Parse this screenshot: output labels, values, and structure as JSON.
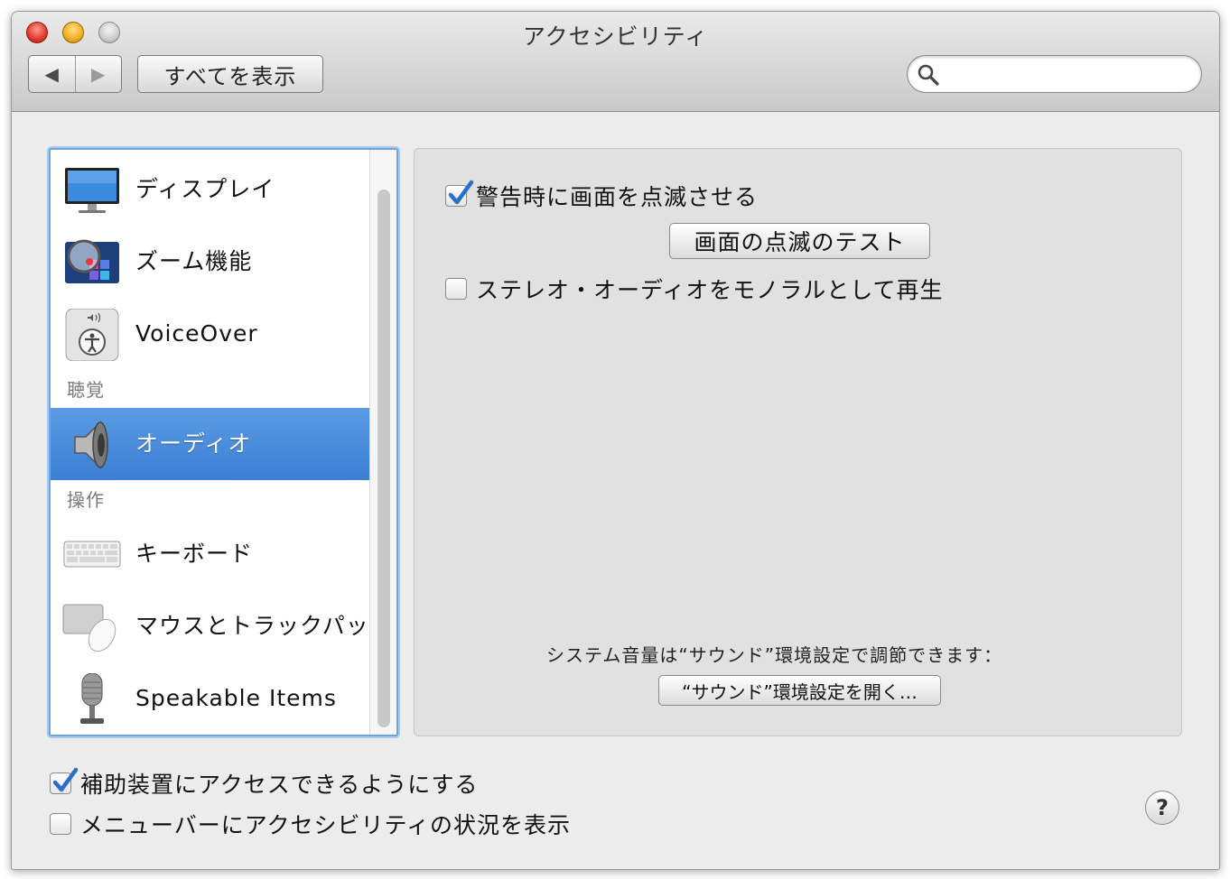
{
  "window": {
    "title": "アクセシビリティ"
  },
  "toolbar": {
    "back_glyph": "◀",
    "forward_glyph": "▶",
    "show_all_label": "すべてを表示",
    "search": {
      "value": "",
      "placeholder": "",
      "icon": "search-icon"
    }
  },
  "sidebar": {
    "items": [
      {
        "label": "ディスプレイ",
        "icon": "display-icon",
        "selected": false
      },
      {
        "label": "ズーム機能",
        "icon": "zoom-icon",
        "selected": false
      },
      {
        "label": "VoiceOver",
        "icon": "voiceover-icon",
        "selected": false
      },
      {
        "label": "オーディオ",
        "icon": "speaker-icon",
        "selected": true
      },
      {
        "label": "キーボード",
        "icon": "keyboard-icon",
        "selected": false
      },
      {
        "label": "マウスとトラックパッ",
        "icon": "mouse-trackpad-icon",
        "selected": false
      },
      {
        "label": "Speakable Items",
        "icon": "microphone-icon",
        "selected": false
      }
    ],
    "sections": {
      "hearing": "聴覚",
      "interaction": "操作"
    }
  },
  "panel": {
    "flash_screen": {
      "label": "警告時に画面を点滅させる",
      "checked": true
    },
    "test_flash_button": "画面の点滅のテスト",
    "mono_audio": {
      "label": "ステレオ・オーディオをモノラルとして再生",
      "checked": false
    },
    "volume_note": "システム音量は“サウンド”環境設定で調節できます：",
    "open_sound_button": "“サウンド”環境設定を開く…"
  },
  "footer": {
    "assistive_devices": {
      "label": "補助装置にアクセスできるようにする",
      "checked": true
    },
    "menubar_status": {
      "label": "メニューバーにアクセシビリティの状況を表示",
      "checked": false
    },
    "help_glyph": "?"
  },
  "colors": {
    "selection": "#3a7fd4",
    "focus_ring": "#6da4e0",
    "check_blue": "#2a6fc9"
  }
}
